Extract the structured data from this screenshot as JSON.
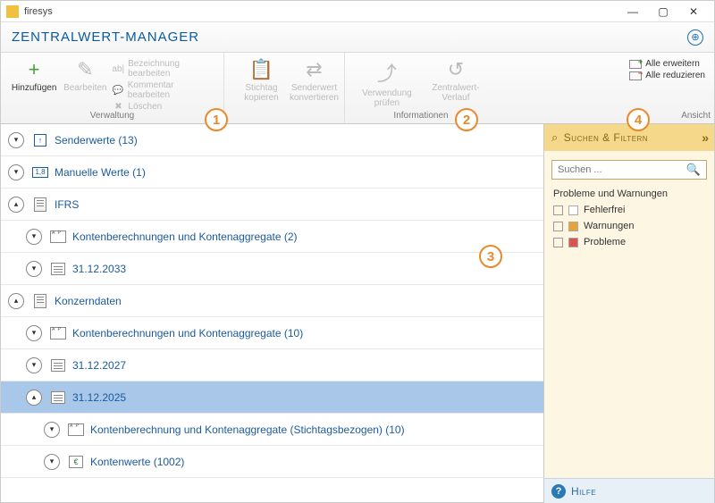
{
  "window": {
    "title": "firesys"
  },
  "header": {
    "title": "ZENTRALWERT-MANAGER"
  },
  "ribbon": {
    "verwaltung": {
      "label": "Verwaltung",
      "hinzufuegen": "Hinzufügen",
      "bearbeiten": "Bearbeiten",
      "bezeichnung": "Bezeichnung bearbeiten",
      "kommentar": "Kommentar bearbeiten",
      "loeschen": "Löschen",
      "stichtag": "Stichtag kopieren",
      "senderwert": "Senderwert",
      "konvertieren": "konvertieren"
    },
    "informationen": {
      "label": "Informationen",
      "verwendung": "Verwendung prüfen",
      "verlauf": "Zentralwert-Verlauf"
    },
    "ansicht": {
      "label": "Ansicht",
      "erweitern": "Alle erweitern",
      "reduzieren": "Alle reduzieren"
    }
  },
  "callouts": {
    "c1": "1",
    "c2": "2",
    "c3": "3",
    "c4": "4"
  },
  "tree": {
    "r1": "Senderwerte (13)",
    "r2": "Manuelle Werte (1)",
    "r3": "IFRS",
    "r4": "Kontenberechnungen und Kontenaggregate (2)",
    "r5": "31.12.2033",
    "r6": "Konzerndaten",
    "r7": "Kontenberechnungen und Kontenaggregate (10)",
    "r8": "31.12.2027",
    "r9": "31.12.2025",
    "r10": "Kontenberechnung und Kontenaggregate (Stichtagsbezogen) (10)",
    "r11": "Kontenwerte (1002)"
  },
  "side": {
    "header": "Suchen & Filtern",
    "search_placeholder": "Suchen ...",
    "filter_title": "Probleme und Warnungen",
    "fehlerfrei": "Fehlerfrei",
    "warnungen": "Warnungen",
    "probleme": "Probleme",
    "hilfe": "Hilfe"
  }
}
